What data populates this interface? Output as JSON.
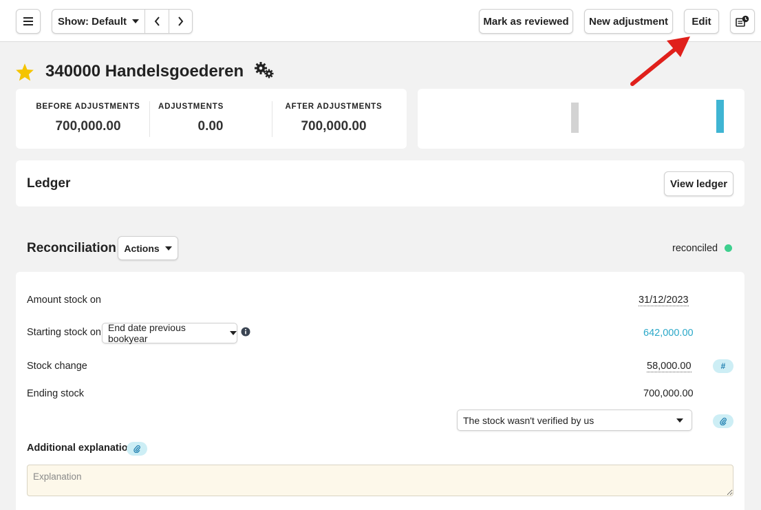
{
  "toolbar": {
    "menu_icon": "hamburger-icon",
    "show_label": "Show: Default",
    "prev_icon": "chevron-left-icon",
    "next_icon": "chevron-right-icon",
    "mark_reviewed": "Mark as reviewed",
    "new_adjustment": "New adjustment",
    "edit": "Edit",
    "history_icon": "document-history-icon"
  },
  "account": {
    "title": "340000 Handelsgoederen",
    "star_icon": "star-icon",
    "settings_icon": "gears-icon"
  },
  "summary": {
    "before_label": "BEFORE ADJUSTMENTS",
    "before_value": "700,000.00",
    "adjustments_label": "ADJUSTMENTS",
    "adjustments_value": "0.00",
    "after_label": "AFTER ADJUSTMENTS",
    "after_value": "700,000.00"
  },
  "ledger": {
    "title": "Ledger",
    "view_button": "View ledger"
  },
  "reconciliation": {
    "title": "Reconciliation",
    "actions_label": "Actions",
    "status_text": "reconciled",
    "status_color": "#3ecf8e",
    "rows": {
      "amount_stock_label": "Amount stock on",
      "amount_stock_date": "31/12/2023",
      "starting_stock_label": "Starting stock on:",
      "starting_stock_select": "End date previous bookyear",
      "starting_stock_value": "642,000.00",
      "stock_change_label": "Stock change",
      "stock_change_value": "58,000.00",
      "ending_stock_label": "Ending stock",
      "ending_stock_value": "700,000.00",
      "verification_select": "The stock wasn't verified by us"
    },
    "additional_explanation_label": "Additional explanation",
    "explanation_placeholder": "Explanation"
  },
  "colors": {
    "accent": "#2aa8c8",
    "star": "#f5c400",
    "arrow": "#e0201b",
    "chart_bar_before": "#d3d3d3",
    "chart_bar_after": "#3fb5d3"
  }
}
